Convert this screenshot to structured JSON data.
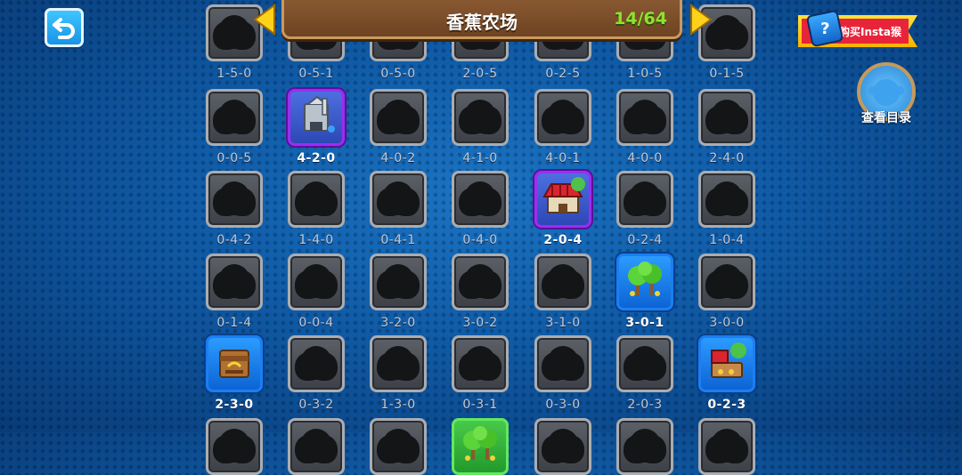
{
  "header": {
    "title": "香蕉农场",
    "count": "14/64"
  },
  "insta": {
    "label": "购买Insta猴"
  },
  "catalog": {
    "label": "查看目录"
  },
  "colors": {
    "owned_purple": "#9a2ef0",
    "owned_blue": "#1c7ef0",
    "count_green": "#8fe22e",
    "header_brown": "#7a4c28"
  },
  "rows": [
    [
      {
        "label": "1-5-0",
        "state": "locked"
      },
      {
        "label": "0-5-1",
        "state": "locked"
      },
      {
        "label": "0-5-0",
        "state": "locked"
      },
      {
        "label": "2-0-5",
        "state": "locked"
      },
      {
        "label": "0-2-5",
        "state": "locked"
      },
      {
        "label": "1-0-5",
        "state": "locked"
      },
      {
        "label": "0-1-5",
        "state": "locked"
      }
    ],
    [
      {
        "label": "0-0-5",
        "state": "locked"
      },
      {
        "label": "4-2-0",
        "state": "purple",
        "icon": "bank-icon"
      },
      {
        "label": "4-0-2",
        "state": "locked"
      },
      {
        "label": "4-1-0",
        "state": "locked"
      },
      {
        "label": "4-0-1",
        "state": "locked"
      },
      {
        "label": "4-0-0",
        "state": "locked"
      },
      {
        "label": "2-4-0",
        "state": "locked"
      }
    ],
    [
      {
        "label": "0-4-2",
        "state": "locked"
      },
      {
        "label": "1-4-0",
        "state": "locked"
      },
      {
        "label": "0-4-1",
        "state": "locked"
      },
      {
        "label": "0-4-0",
        "state": "locked"
      },
      {
        "label": "2-0-4",
        "state": "purple",
        "icon": "market-icon"
      },
      {
        "label": "0-2-4",
        "state": "locked"
      },
      {
        "label": "1-0-4",
        "state": "locked"
      }
    ],
    [
      {
        "label": "0-1-4",
        "state": "locked"
      },
      {
        "label": "0-0-4",
        "state": "locked"
      },
      {
        "label": "3-2-0",
        "state": "locked"
      },
      {
        "label": "3-0-2",
        "state": "locked"
      },
      {
        "label": "3-1-0",
        "state": "locked"
      },
      {
        "label": "3-0-1",
        "state": "blue",
        "icon": "banana-trees-icon"
      },
      {
        "label": "3-0-0",
        "state": "locked"
      }
    ],
    [
      {
        "label": "2-3-0",
        "state": "blue",
        "icon": "crate-icon"
      },
      {
        "label": "0-3-2",
        "state": "locked"
      },
      {
        "label": "1-3-0",
        "state": "locked"
      },
      {
        "label": "0-3-1",
        "state": "locked"
      },
      {
        "label": "0-3-0",
        "state": "locked"
      },
      {
        "label": "2-0-3",
        "state": "locked"
      },
      {
        "label": "0-2-3",
        "state": "blue",
        "icon": "stand-icon"
      }
    ],
    [
      {
        "label": "",
        "state": "locked"
      },
      {
        "label": "",
        "state": "locked"
      },
      {
        "label": "",
        "state": "locked"
      },
      {
        "label": "",
        "state": "green",
        "icon": "banana-trees-icon"
      },
      {
        "label": "",
        "state": "locked"
      },
      {
        "label": "",
        "state": "locked"
      },
      {
        "label": "",
        "state": "locked"
      }
    ]
  ]
}
